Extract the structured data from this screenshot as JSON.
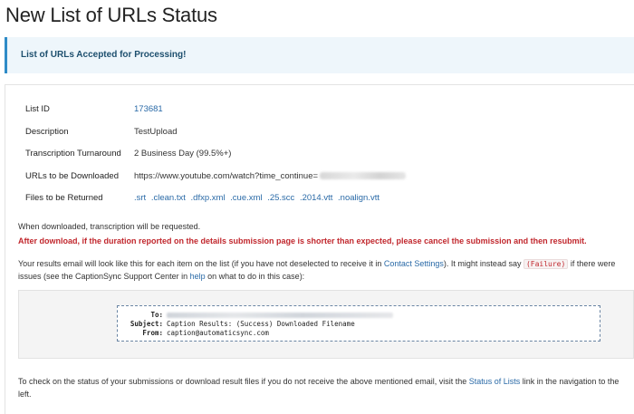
{
  "page": {
    "title": "New List of URLs Status"
  },
  "alert": {
    "message": "List of URLs Accepted for Processing!"
  },
  "details": {
    "rows": [
      {
        "label": "List ID",
        "value": "173681"
      },
      {
        "label": "Description",
        "value": "TestUpload"
      },
      {
        "label": "Transcription Turnaround",
        "value": "2 Business Day (99.5%+)"
      },
      {
        "label": "URLs to be Downloaded",
        "value": "https://www.youtube.com/watch?time_continue="
      },
      {
        "label": "Files to be Returned",
        "files": [
          ".srt",
          ".clean.txt",
          ".dfxp.xml",
          ".cue.xml",
          ".25.scc",
          ".2014.vtt",
          ".noalign.vtt"
        ]
      }
    ]
  },
  "info": {
    "line1": "When downloaded, transcription will be requested.",
    "warning": "After download, if the duration reported on the details submission page is shorter than expected, please cancel the submission and then resubmit.",
    "p2_a": "Your results email will look like this for each item on the list (if you have not deselected to receive it in ",
    "p2_link1": "Contact Settings",
    "p2_b": "). It might instead say ",
    "p2_code": "(Failure)",
    "p2_c": " if there were issues (see the CaptionSync Support Center in ",
    "p2_link2": "help",
    "p2_d": " on what to do in this case):"
  },
  "email_example": {
    "to_label": "To:",
    "subject_label": "Subject:",
    "subject_value": "Caption Results: (Success) Downloaded Filename",
    "from_label": "From:",
    "from_value": "caption@automaticsync.com"
  },
  "footer": {
    "text_a": "To check on the status of your submissions or download result files if you do not receive the above mentioned email, visit the ",
    "link": "Status of Lists",
    "text_b": " link in the navigation to the left."
  }
}
